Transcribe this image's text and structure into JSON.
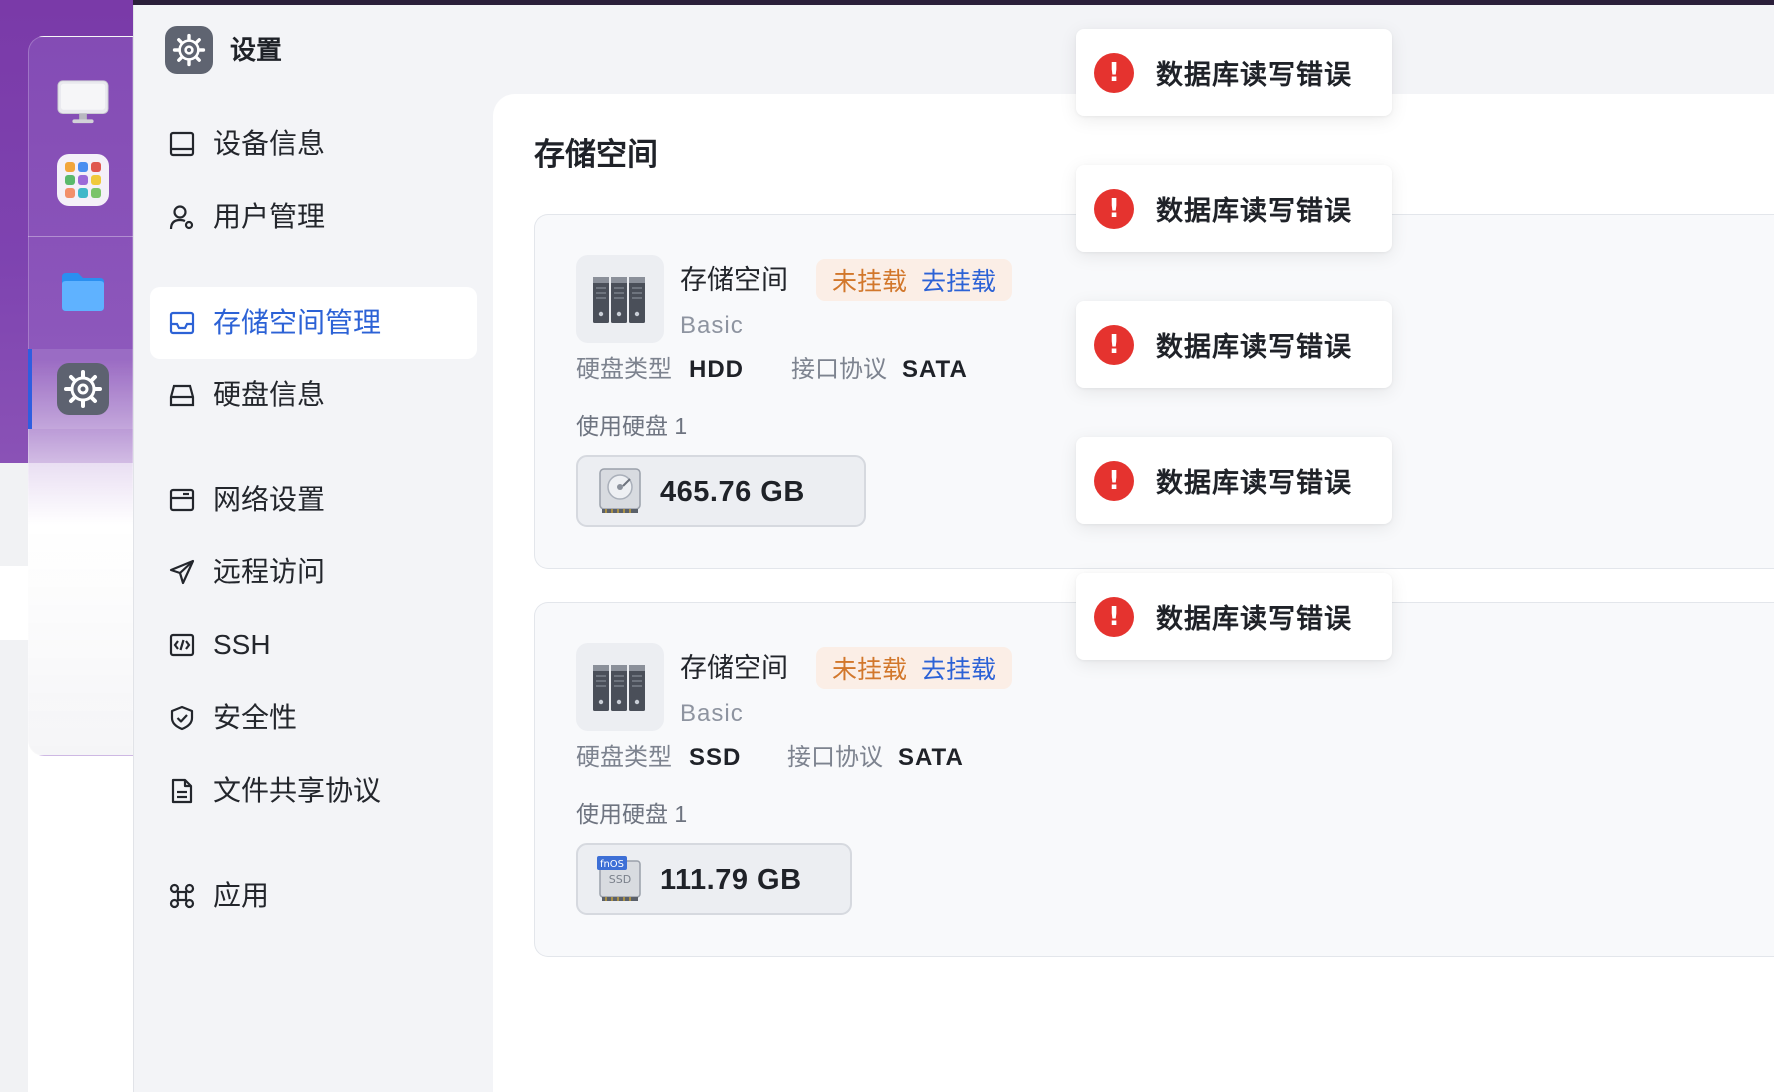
{
  "app": {
    "title": "设置",
    "icon": "gear-icon"
  },
  "dock": {
    "items": [
      {
        "name": "monitor-icon"
      },
      {
        "name": "app-grid-icon"
      },
      {
        "name": "folder-icon"
      },
      {
        "name": "settings-gear-icon",
        "active": true
      }
    ]
  },
  "sidebar": {
    "items": [
      {
        "label": "设备信息",
        "icon": "device-icon"
      },
      {
        "label": "用户管理",
        "icon": "user-icon"
      },
      {
        "label": "存储空间管理",
        "icon": "storage-icon",
        "active": true
      },
      {
        "label": "硬盘信息",
        "icon": "disk-icon"
      },
      {
        "label": "网络设置",
        "icon": "network-icon"
      },
      {
        "label": "远程访问",
        "icon": "send-icon"
      },
      {
        "label": "SSH",
        "icon": "code-icon"
      },
      {
        "label": "安全性",
        "icon": "shield-icon"
      },
      {
        "label": "文件共享协议",
        "icon": "document-icon"
      },
      {
        "label": "应用",
        "icon": "command-icon"
      }
    ]
  },
  "main": {
    "title": "存储空间",
    "cards": [
      {
        "name": "存储空间",
        "status": "未挂载",
        "action": "去挂载",
        "raid": "Basic",
        "disk_type_label": "硬盘类型",
        "disk_type": "HDD",
        "interface_label": "接口协议",
        "interface": "SATA",
        "used_disks": "使用硬盘 1",
        "disk_size": "465.76 GB",
        "disk_kind": "hdd"
      },
      {
        "name": "存储空间",
        "status": "未挂载",
        "action": "去挂载",
        "raid": "Basic",
        "disk_type_label": "硬盘类型",
        "disk_type": "SSD",
        "interface_label": "接口协议",
        "interface": "SATA",
        "used_disks": "使用硬盘 1",
        "disk_size": "111.79 GB",
        "disk_kind": "ssd",
        "ssd_badge_top": "fnOS",
        "ssd_badge_bottom": "SSD"
      }
    ]
  },
  "toasts": [
    {
      "message": "数据库读写错误",
      "icon": "error-icon",
      "icon_glyph": "!"
    },
    {
      "message": "数据库读写错误",
      "icon": "error-icon",
      "icon_glyph": "!"
    },
    {
      "message": "数据库读写错误",
      "icon": "error-icon",
      "icon_glyph": "!"
    },
    {
      "message": "数据库读写错误",
      "icon": "error-icon",
      "icon_glyph": "!"
    },
    {
      "message": "数据库读写错误",
      "icon": "error-icon",
      "icon_glyph": "!"
    }
  ],
  "colors": {
    "accent": "#2c62d6",
    "status_warning": "#d2772b",
    "status_warning_bg": "#fbeee6",
    "error": "#e5332f",
    "dock_purple": "#7a3aa8"
  }
}
